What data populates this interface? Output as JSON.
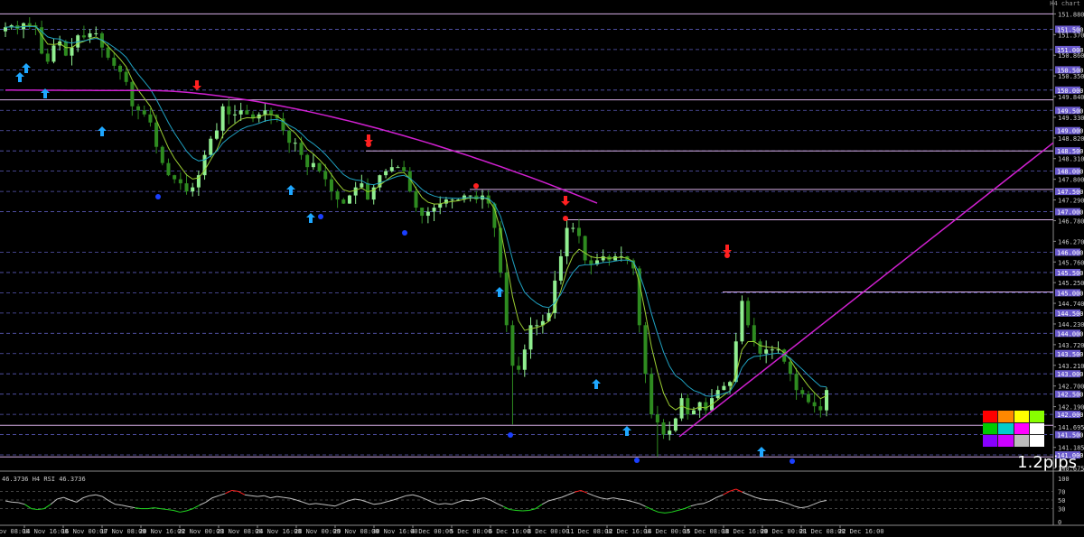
{
  "window": {
    "symbol_label": "H4 chart"
  },
  "spread_label": "1.2pips",
  "rsi_header": "46.3736 H4 RSI 46.3736",
  "colors": {
    "background": "#000000",
    "bull_candle": "#90ee90",
    "bear_candle": "#2e8b20",
    "fast_ma": "#9acd32",
    "slow_ma": "#1fa0c0",
    "long_ma": "#d020d0",
    "trendline": "#d020d0",
    "level_line": "#d8b0e8",
    "grid_dash": "#5a5ab8",
    "up_arrow": "#1ea7ff",
    "down_arrow": "#ff2020",
    "rsi_line": "#c0c0c0",
    "rsi_oversold": "#22dd22",
    "rsi_overbought": "#ff2020",
    "price_tag": "#6a5acd"
  },
  "color_panel": [
    "#ff0000",
    "#ff8800",
    "#ffff00",
    "#88ff00",
    "#00cc00",
    "#00cccc",
    "#ff00ff",
    "#ffffff",
    "#8800ff",
    "#cc00ff",
    "#bbbbbb",
    "#ffffff"
  ],
  "chart_data": {
    "type": "candlestick",
    "timeframe": "H4",
    "price_axis": {
      "labels": [
        "151.880",
        "151.370",
        "150.860",
        "150.350",
        "149.840",
        "149.330",
        "148.820",
        "148.310",
        "147.800",
        "147.290",
        "146.780",
        "146.270",
        "145.760",
        "145.250",
        "144.740",
        "144.230",
        "143.720",
        "143.210",
        "142.700",
        "142.190",
        "141.695",
        "141.185",
        "140.675"
      ],
      "range": [
        140.6,
        152.0
      ]
    },
    "price_tags": [
      "151.500",
      "151.000",
      "150.500",
      "150.000",
      "149.500",
      "149.000",
      "148.500",
      "148.000",
      "147.500",
      "147.000",
      "146.000",
      "145.500",
      "145.000",
      "144.500",
      "144.000",
      "143.500",
      "143.000",
      "142.500",
      "142.000",
      "141.500",
      "141.000"
    ],
    "time_labels": [
      "13 Nov 08:00",
      "14 Nov 16:00",
      "16 Nov 00:00",
      "17 Nov 08:00",
      "20 Nov 16:00",
      "22 Nov 00:00",
      "23 Nov 08:00",
      "24 Nov 16:00",
      "28 Nov 00:00",
      "29 Nov 08:00",
      "30 Nov 16:00",
      "4 Dec 00:00",
      "5 Dec 08:00",
      "6 Dec 16:00",
      "8 Dec 00:00",
      "11 Dec 08:00",
      "12 Dec 16:00",
      "14 Dec 00:00",
      "15 Dec 08:00",
      "18 Dec 16:00",
      "20 Dec 00:00",
      "21 Dec 08:00",
      "22 Dec 16:00"
    ],
    "horizontal_levels": [
      151.88,
      149.76,
      148.5,
      147.55,
      146.8,
      145.02,
      141.73,
      140.95
    ],
    "closes": [
      151.55,
      151.6,
      151.5,
      151.65,
      151.6,
      151.55,
      150.9,
      150.7,
      151.1,
      151.2,
      150.85,
      151.05,
      151.35,
      151.3,
      151.4,
      151.4,
      151.05,
      150.8,
      150.6,
      150.45,
      150.2,
      149.6,
      149.5,
      149.4,
      149.2,
      148.6,
      148.2,
      147.9,
      147.8,
      147.7,
      147.5,
      147.6,
      147.9,
      148.4,
      148.8,
      149.0,
      149.6,
      149.4,
      149.4,
      149.5,
      149.4,
      149.3,
      149.4,
      149.5,
      149.4,
      149.3,
      149.0,
      148.7,
      148.7,
      148.4,
      148.1,
      148.2,
      148.0,
      147.8,
      147.5,
      147.3,
      147.2,
      147.4,
      147.6,
      147.7,
      147.3,
      147.6,
      147.9,
      148.0,
      148.1,
      148.1,
      148.0,
      147.5,
      147.1,
      146.9,
      147.0,
      147.1,
      147.2,
      147.3,
      147.3,
      147.3,
      147.4,
      147.4,
      147.3,
      147.4,
      147.2,
      146.6,
      145.5,
      144.2,
      143.2,
      143.1,
      143.6,
      144.2,
      144.2,
      144.3,
      144.5,
      145.3,
      145.9,
      146.6,
      146.6,
      146.4,
      145.8,
      145.7,
      145.8,
      145.9,
      145.8,
      145.9,
      145.9,
      145.8,
      145.6,
      144.2,
      143.0,
      142.0,
      141.8,
      141.5,
      141.6,
      141.9,
      142.4,
      142.0,
      142.1,
      142.3,
      142.1,
      142.4,
      142.6,
      142.7,
      142.8,
      143.8,
      144.8,
      144.2,
      143.8,
      143.5,
      143.6,
      143.6,
      143.6,
      143.3,
      143.0,
      142.6,
      142.5,
      142.3,
      142.2,
      142.1,
      142.6
    ],
    "rsi": {
      "levels": [
        70,
        50,
        30
      ],
      "axis_labels": [
        "100",
        "70",
        "50",
        "30",
        "0"
      ],
      "current": 46.3736,
      "values": [
        48,
        45,
        44,
        40,
        30,
        28,
        30,
        40,
        52,
        56,
        50,
        45,
        55,
        60,
        62,
        58,
        48,
        40,
        38,
        35,
        32,
        30,
        30,
        32,
        30,
        28,
        26,
        22,
        25,
        30,
        38,
        45,
        55,
        60,
        65,
        72,
        70,
        62,
        60,
        58,
        60,
        55,
        58,
        56,
        54,
        50,
        45,
        40,
        42,
        40,
        38,
        36,
        42,
        48,
        52,
        50,
        45,
        40,
        42,
        46,
        50,
        55,
        60,
        62,
        58,
        52,
        45,
        40,
        42,
        40,
        45,
        50,
        48,
        52,
        55,
        50,
        42,
        35,
        28,
        26,
        25,
        26,
        30,
        40,
        48,
        52,
        56,
        62,
        68,
        72,
        66,
        60,
        55,
        52,
        55,
        52,
        50,
        46,
        42,
        35,
        28,
        22,
        20,
        22,
        26,
        30,
        36,
        40,
        42,
        48,
        56,
        62,
        70,
        75,
        68,
        62,
        56,
        52,
        50,
        50,
        46,
        42,
        36,
        32,
        34,
        40,
        46,
        49
      ]
    },
    "annotations": {
      "up_arrows": 10,
      "down_arrows": 4
    }
  }
}
